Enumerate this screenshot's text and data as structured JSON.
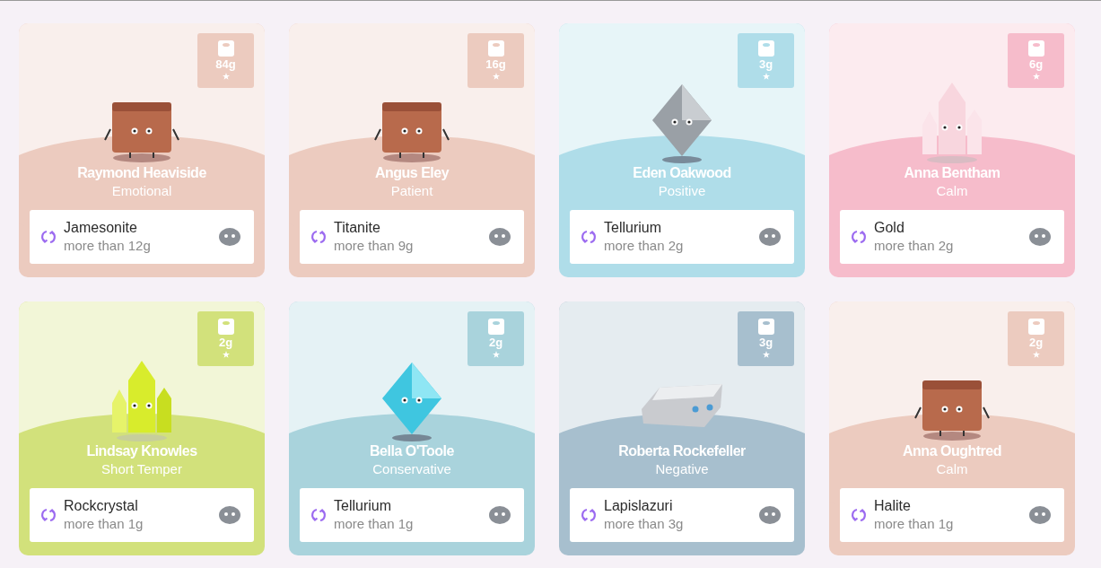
{
  "cards": [
    {
      "name": "Raymond Heaviside",
      "trait": "Emotional",
      "weight": "84g",
      "kind": "block",
      "color": "#eccbbf",
      "mineral": "Jamesonite",
      "requirement": "more than 12g"
    },
    {
      "name": "Angus Eley",
      "trait": "Patient",
      "weight": "16g",
      "kind": "block",
      "color": "#eccbbf",
      "mineral": "Titanite",
      "requirement": "more than 9g"
    },
    {
      "name": "Eden Oakwood",
      "trait": "Positive",
      "weight": "3g",
      "kind": "octahedron",
      "color": "#afdde9",
      "mineral": "Tellurium",
      "requirement": "more than 2g"
    },
    {
      "name": "Anna Bentham",
      "trait": "Calm",
      "weight": "6g",
      "kind": "crystal",
      "color": "#f6bccb",
      "mineral": "Gold",
      "requirement": "more than 2g"
    },
    {
      "name": "Lindsay Knowles",
      "trait": "Short Temper",
      "weight": "2g",
      "kind": "crystal",
      "color": "#d2e17b",
      "mineral": "Rockcrystal",
      "requirement": "more than 1g"
    },
    {
      "name": "Bella O'Toole",
      "trait": "Conservative",
      "weight": "2g",
      "kind": "octahedron",
      "color": "#a9d3dc",
      "mineral": "Tellurium",
      "requirement": "more than 1g"
    },
    {
      "name": "Roberta Rockefeller",
      "trait": "Negative",
      "weight": "3g",
      "kind": "bar",
      "color": "#a7bfce",
      "mineral": "Lapislazuri",
      "requirement": "more than 3g"
    },
    {
      "name": "Anna Oughtred",
      "trait": "Calm",
      "weight": "2g",
      "kind": "block",
      "color": "#eccbbf",
      "mineral": "Halite",
      "requirement": "more than 1g"
    }
  ]
}
